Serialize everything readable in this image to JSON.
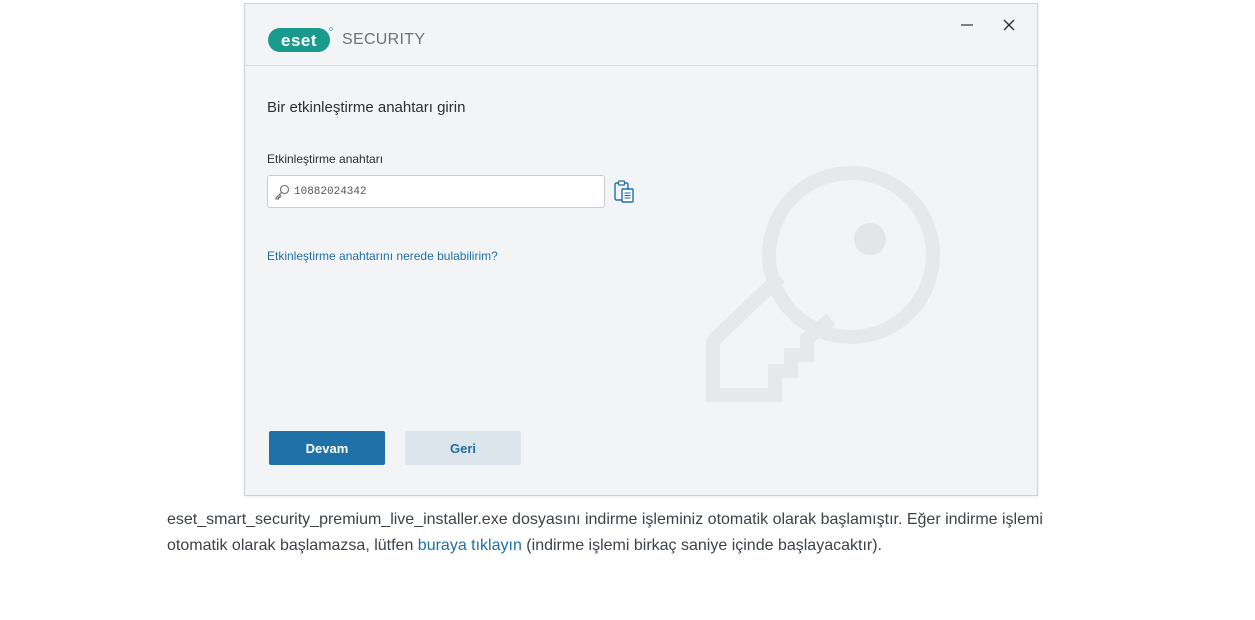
{
  "app": {
    "brand": "eset",
    "product": "SECURITY"
  },
  "window_controls": {
    "minimize_icon": "minimize-icon",
    "close_icon": "close-icon"
  },
  "form": {
    "heading": "Bir etkinleştirme anahtarı girin",
    "field_label": "Etkinleştirme anahtarı",
    "key_value": "10882024342",
    "help_link": "Etkinleştirme anahtarını nerede bulabilirim?"
  },
  "buttons": {
    "continue": "Devam",
    "back": "Geri"
  },
  "notice": {
    "text_before": "eset_smart_security_premium_live_installer.exe dosyasını indirme işleminiz otomatik olarak başlamıştır. Eğer indirme işlemi otomatik olarak başlamazsa, lütfen ",
    "link": "buraya tıklayın",
    "text_after": " (indirme işlemi birkaç saniye içinde başlayacaktır)."
  },
  "colors": {
    "brand_teal": "#1a9a8c",
    "primary_button": "#1e72a8",
    "link": "#1f6fa8",
    "window_bg": "#f3f4f6"
  }
}
